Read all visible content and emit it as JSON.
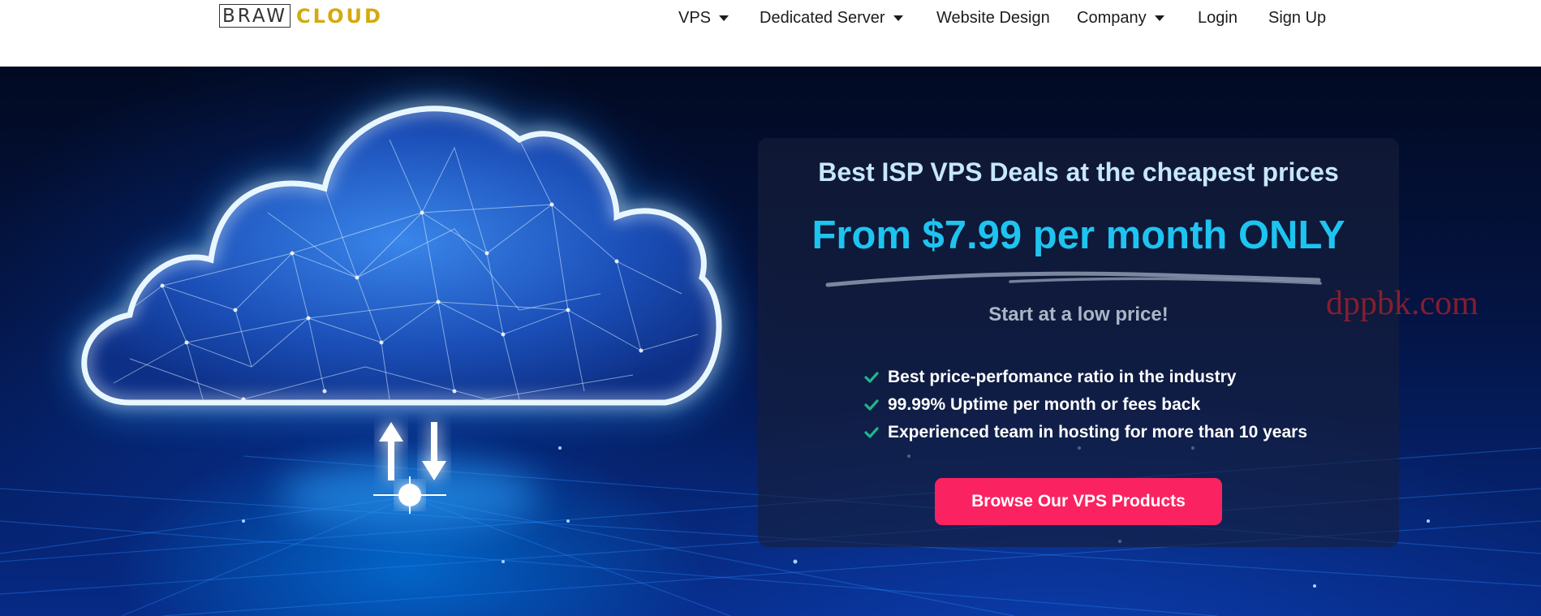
{
  "brand": {
    "part1": "BRAW",
    "part2": "CLOUD"
  },
  "nav": [
    {
      "label": "VPS",
      "dropdown": true
    },
    {
      "label": "Dedicated Server",
      "dropdown": true
    },
    {
      "label": "Website Design",
      "dropdown": false
    },
    {
      "label": "Company",
      "dropdown": true
    },
    {
      "label": "Login",
      "dropdown": false
    },
    {
      "label": "Sign Up",
      "dropdown": false
    }
  ],
  "hero": {
    "heading": "Best ISP VPS Deals at the cheapest prices",
    "price": "From $7.99 per month ONLY",
    "subheading": "Start at a low price!",
    "features": [
      "Best price-perfomance ratio in the industry",
      "99.99% Uptime per month or fees back",
      "Experienced team in hosting for more than 10 years"
    ],
    "cta_label": "Browse Our VPS Products",
    "watermark": "dppbk.com"
  },
  "colors": {
    "brand_gold": "#d5a90f",
    "price_cyan": "#1ec4f0",
    "cta_pink": "#fb2261",
    "check_green": "#1fb788",
    "hero_dark": "#041443"
  },
  "icons": [
    "chevron-down-icon",
    "check-icon",
    "arrow-up-icon",
    "arrow-down-icon",
    "cloud-illustration"
  ]
}
